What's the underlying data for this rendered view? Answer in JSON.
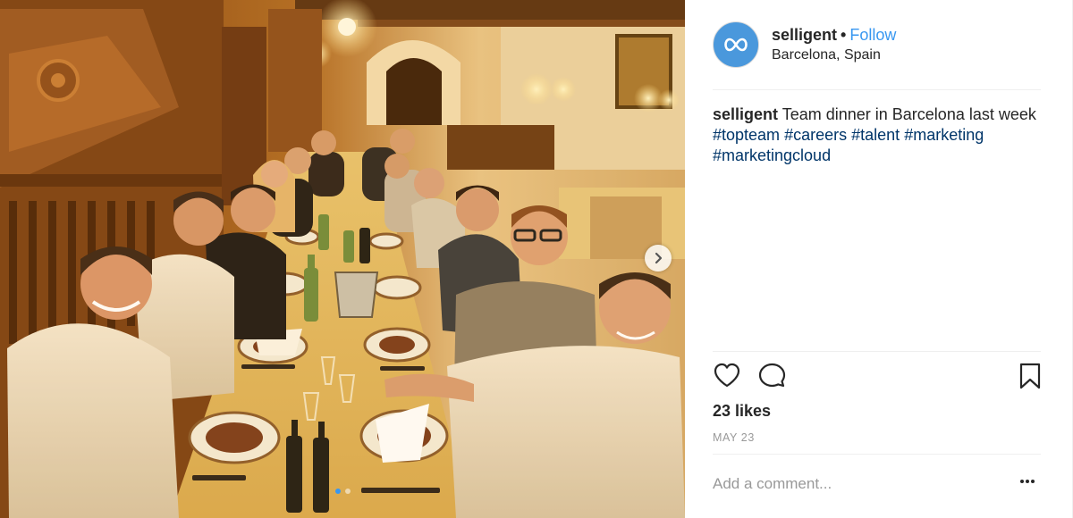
{
  "post": {
    "username": "selligent",
    "separator": "•",
    "follow_label": "Follow",
    "location": "Barcelona, Spain",
    "caption": {
      "username": "selligent",
      "text": "Team dinner in Barcelona last week",
      "hashtags": [
        "#topteam",
        "#careers",
        "#talent",
        "#marketing",
        "#marketingcloud"
      ]
    },
    "likes": "23 likes",
    "date": "MAY 23",
    "comment_placeholder": "Add a comment...",
    "carousel": {
      "total": 2,
      "current": 1
    }
  },
  "icons": {
    "avatar": "selligent-logo-icon",
    "next": "chevron-right-icon",
    "like": "heart-icon",
    "comment": "comment-bubble-icon",
    "save": "bookmark-icon",
    "more": "more-options-icon"
  },
  "colors": {
    "accent": "#3897f0",
    "hashtag": "#003569",
    "avatar_bg": "#4a98dc",
    "muted": "#999999",
    "text": "#262626"
  }
}
